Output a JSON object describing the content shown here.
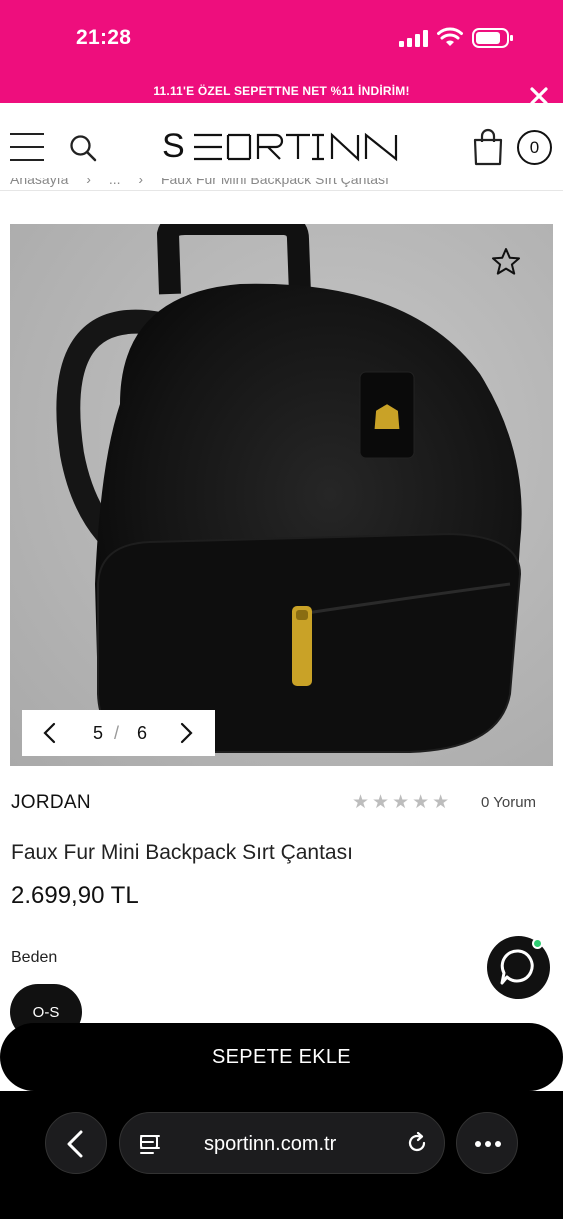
{
  "status_bar": {
    "time": "21:28"
  },
  "promo": {
    "text": "11.11'E ÖZEL SEPETTNE NET  %11 İNDİRİM!"
  },
  "header": {
    "logo": "SPORTINN",
    "cart_count": "0"
  },
  "breadcrumb": {
    "items": [
      "Anasayfa",
      "...",
      "Faux Fur Mini Backpack Sırt Çantası"
    ]
  },
  "gallery": {
    "current": "5",
    "separator": "/",
    "total": "6"
  },
  "product": {
    "brand": "JORDAN",
    "stars": "★★★★★",
    "reviews": "0 Yorum",
    "title": "Faux Fur Mini Backpack Sırt Çantası",
    "price": "2.699,90 TL",
    "size_label": "Beden",
    "selected_size": "O-S"
  },
  "cta": {
    "add_to_cart": "SEPETE EKLE"
  },
  "browser": {
    "url": "sportinn.com.tr"
  },
  "colors": {
    "promo_bg": "#ee0e7d",
    "accent": "#000000",
    "online_dot": "#2ecc71"
  },
  "icons": [
    "menu-icon",
    "search-icon",
    "shopping-bag-icon",
    "star-outline-icon",
    "chevron-left-icon",
    "chevron-right-icon",
    "chat-icon",
    "close-icon",
    "reload-icon",
    "more-icon",
    "tabs-icon"
  ]
}
